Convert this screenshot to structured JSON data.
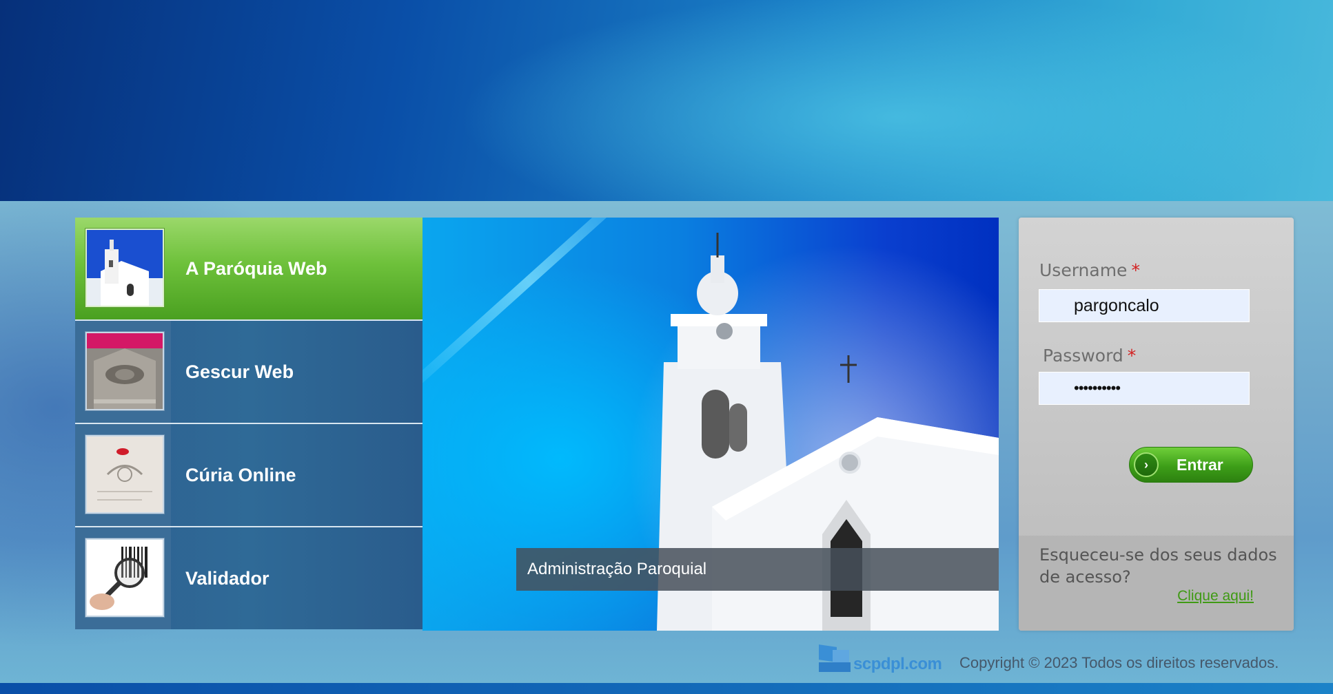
{
  "nav": {
    "items": [
      {
        "label": "A Paróquia Web",
        "active": true
      },
      {
        "label": "Gescur Web",
        "active": false
      },
      {
        "label": "Cúria Online",
        "active": false
      },
      {
        "label": "Validador",
        "active": false
      }
    ]
  },
  "hero": {
    "caption": "Administração Paroquial"
  },
  "login": {
    "username_label": "Username",
    "password_label": "Password",
    "required_mark": "*",
    "username_value": "pargoncalo",
    "password_value": "••••••••••",
    "submit_label": "Entrar",
    "forgot_text": "Esqueceu-se dos seus dados de acesso?",
    "forgot_link": "Clique aqui!"
  },
  "footer": {
    "logo_text": "scpdpl.com",
    "copyright": "Copyright © 2023 Todos os direitos reservados."
  },
  "colors": {
    "accent_green": "#6ec13b",
    "nav_blue": "#2f6a97",
    "link_green": "#3f9a14"
  }
}
